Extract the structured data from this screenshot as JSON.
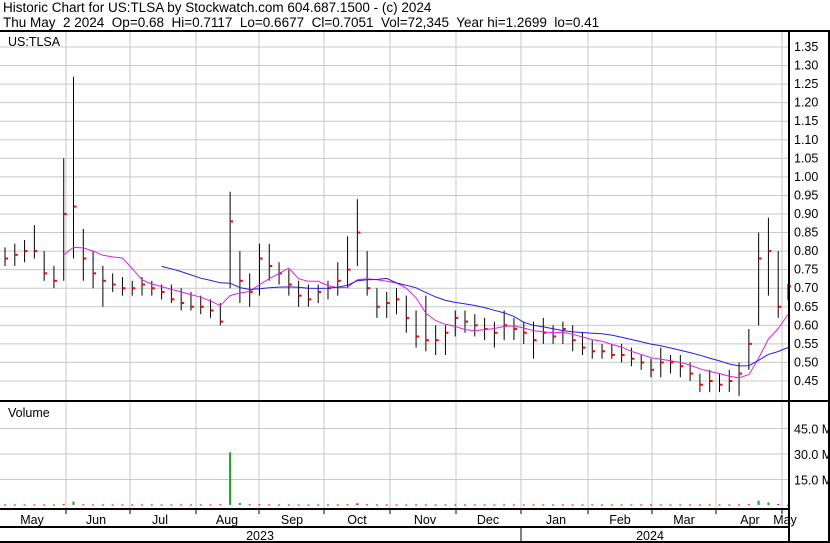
{
  "header": {
    "title": "Historic Chart for US:TLSA by Stockwatch.com 604.687.1500 - (c) 2024",
    "quote_line": "Thu May  2 2024  Op=0.68  Hi=0.7117  Lo=0.6677  Cl=0.7051  Vol=72,345  Year hi=1.2699  lo=0.41"
  },
  "colors": {
    "bar": "#000000",
    "close_tick": "#ff0000",
    "ma_short": "#e020e0",
    "ma_long": "#2020e0",
    "volume": "#20a020",
    "grid": "#c8c8c8"
  },
  "chart_data": {
    "type": "ohlc",
    "symbol_label": "US:TLSA",
    "volume_label": "Volume",
    "price_axis": {
      "ylim": [
        0.41,
        1.37
      ],
      "ticks": [
        "1.35",
        "1.30",
        "1.25",
        "1.20",
        "1.15",
        "1.10",
        "1.05",
        "1.00",
        "0.95",
        "0.90",
        "0.85",
        "0.80",
        "0.75",
        "0.70",
        "0.65",
        "0.60",
        "0.55",
        "0.50",
        "0.45"
      ]
    },
    "volume_axis": {
      "ylim_millions": [
        0,
        52
      ],
      "ticks": [
        {
          "v": 45,
          "label": "45.0 M"
        },
        {
          "v": 30,
          "label": "30.0 M"
        },
        {
          "v": 15,
          "label": "15.0 M"
        }
      ]
    },
    "months": [
      "May",
      "Jun",
      "Jul",
      "Aug",
      "Sep",
      "Oct",
      "Nov",
      "Dec",
      "Jan",
      "Feb",
      "Mar",
      "Apr",
      "May"
    ],
    "years": [
      "2023",
      "2024"
    ],
    "moving_averages": [
      {
        "name": "short",
        "period_bars": 7
      },
      {
        "name": "long",
        "period_bars": 17
      }
    ],
    "bars_hlc": [
      [
        0.81,
        0.76,
        0.78
      ],
      [
        0.82,
        0.76,
        0.79
      ],
      [
        0.83,
        0.77,
        0.8
      ],
      [
        0.87,
        0.78,
        0.8
      ],
      [
        0.8,
        0.72,
        0.74
      ],
      [
        0.76,
        0.7,
        0.72
      ],
      [
        1.05,
        0.72,
        0.9
      ],
      [
        1.27,
        0.78,
        0.92
      ],
      [
        0.86,
        0.72,
        0.78
      ],
      [
        0.8,
        0.7,
        0.74
      ],
      [
        0.76,
        0.65,
        0.72
      ],
      [
        0.74,
        0.69,
        0.71
      ],
      [
        0.73,
        0.68,
        0.7
      ],
      [
        0.72,
        0.68,
        0.7
      ],
      [
        0.73,
        0.68,
        0.71
      ],
      [
        0.72,
        0.68,
        0.7
      ],
      [
        0.71,
        0.67,
        0.69
      ],
      [
        0.71,
        0.66,
        0.67
      ],
      [
        0.7,
        0.64,
        0.66
      ],
      [
        0.69,
        0.64,
        0.65
      ],
      [
        0.68,
        0.63,
        0.65
      ],
      [
        0.67,
        0.62,
        0.64
      ],
      [
        0.66,
        0.6,
        0.61
      ],
      [
        0.96,
        0.7,
        0.88
      ],
      [
        0.8,
        0.66,
        0.72
      ],
      [
        0.74,
        0.65,
        0.69
      ],
      [
        0.82,
        0.68,
        0.78
      ],
      [
        0.82,
        0.72,
        0.76
      ],
      [
        0.77,
        0.71,
        0.74
      ],
      [
        0.75,
        0.68,
        0.71
      ],
      [
        0.72,
        0.65,
        0.68
      ],
      [
        0.71,
        0.65,
        0.67
      ],
      [
        0.71,
        0.66,
        0.69
      ],
      [
        0.72,
        0.67,
        0.7
      ],
      [
        0.77,
        0.68,
        0.72
      ],
      [
        0.84,
        0.7,
        0.75
      ],
      [
        0.94,
        0.76,
        0.85
      ],
      [
        0.8,
        0.68,
        0.7
      ],
      [
        0.7,
        0.62,
        0.65
      ],
      [
        0.69,
        0.62,
        0.66
      ],
      [
        0.7,
        0.63,
        0.67
      ],
      [
        0.68,
        0.58,
        0.62
      ],
      [
        0.64,
        0.54,
        0.57
      ],
      [
        0.68,
        0.53,
        0.56
      ],
      [
        0.6,
        0.52,
        0.56
      ],
      [
        0.6,
        0.52,
        0.58
      ],
      [
        0.64,
        0.57,
        0.62
      ],
      [
        0.64,
        0.58,
        0.61
      ],
      [
        0.63,
        0.57,
        0.6
      ],
      [
        0.62,
        0.56,
        0.59
      ],
      [
        0.61,
        0.54,
        0.58
      ],
      [
        0.64,
        0.56,
        0.6
      ],
      [
        0.62,
        0.56,
        0.59
      ],
      [
        0.61,
        0.55,
        0.58
      ],
      [
        0.61,
        0.51,
        0.56
      ],
      [
        0.62,
        0.55,
        0.58
      ],
      [
        0.6,
        0.55,
        0.57
      ],
      [
        0.61,
        0.55,
        0.59
      ],
      [
        0.6,
        0.53,
        0.56
      ],
      [
        0.58,
        0.52,
        0.54
      ],
      [
        0.56,
        0.51,
        0.53
      ],
      [
        0.55,
        0.51,
        0.53
      ],
      [
        0.55,
        0.51,
        0.52
      ],
      [
        0.55,
        0.5,
        0.52
      ],
      [
        0.54,
        0.49,
        0.51
      ],
      [
        0.52,
        0.48,
        0.5
      ],
      [
        0.51,
        0.46,
        0.48
      ],
      [
        0.54,
        0.46,
        0.5
      ],
      [
        0.52,
        0.47,
        0.5
      ],
      [
        0.52,
        0.46,
        0.49
      ],
      [
        0.5,
        0.45,
        0.47
      ],
      [
        0.47,
        0.42,
        0.44
      ],
      [
        0.48,
        0.42,
        0.45
      ],
      [
        0.47,
        0.42,
        0.44
      ],
      [
        0.48,
        0.42,
        0.45
      ],
      [
        0.5,
        0.41,
        0.47
      ],
      [
        0.59,
        0.48,
        0.55
      ],
      [
        0.85,
        0.6,
        0.78
      ],
      [
        0.89,
        0.68,
        0.8
      ],
      [
        0.8,
        0.62,
        0.65
      ],
      [
        0.7117,
        0.6677,
        0.7051
      ]
    ],
    "volume_millions": [
      0.3,
      0.3,
      0.3,
      0.3,
      0.3,
      0.3,
      0.5,
      2.0,
      0.4,
      0.3,
      0.3,
      0.3,
      0.3,
      0.3,
      0.3,
      0.3,
      0.3,
      0.3,
      0.3,
      0.3,
      0.3,
      0.3,
      0.4,
      31.0,
      1.2,
      0.4,
      0.4,
      0.3,
      0.3,
      0.3,
      0.3,
      0.3,
      0.3,
      0.3,
      0.3,
      0.4,
      1.0,
      0.4,
      0.3,
      0.3,
      0.3,
      0.3,
      0.3,
      0.3,
      0.3,
      0.3,
      0.3,
      0.3,
      0.3,
      0.3,
      0.3,
      0.3,
      0.3,
      0.3,
      0.3,
      0.3,
      0.3,
      0.3,
      0.3,
      0.3,
      0.3,
      0.3,
      0.3,
      0.3,
      0.3,
      0.3,
      0.3,
      0.3,
      0.3,
      0.3,
      0.3,
      0.3,
      0.3,
      0.3,
      0.3,
      0.3,
      0.5,
      2.5,
      1.5,
      0.6,
      0.1
    ]
  }
}
